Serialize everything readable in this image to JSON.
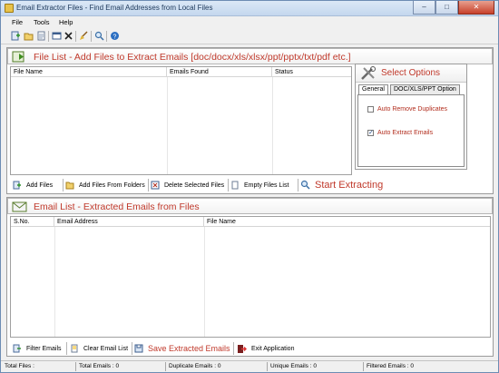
{
  "window": {
    "title": "Email Extractor Files -  Find Email Addresses from Local Files",
    "buttons": [
      "–",
      "□",
      "✕"
    ]
  },
  "menu": [
    "File",
    "Tools",
    "Help"
  ],
  "file_list": {
    "header": "File List - Add Files to Extract Emails [doc/docx/xls/xlsx/ppt/pptx/txt/pdf etc.]",
    "columns": [
      "File Name",
      "Emails Found",
      "Status"
    ]
  },
  "options": {
    "title": "Select Options",
    "tabs": [
      "General",
      "DOC/XLS/PPT Option"
    ],
    "checkboxes": [
      {
        "label": "Auto Remove Duplicates",
        "checked": false
      },
      {
        "label": "Auto Extract Emails",
        "checked": true
      }
    ]
  },
  "file_actions": {
    "add_files": "Add Files",
    "add_folders": "Add Files From Folders",
    "delete_selected": "Delete Selected Files",
    "empty_list": "Empty Files List",
    "start": "Start Extracting"
  },
  "email_list": {
    "header": "Email List - Extracted Emails from Files",
    "columns": [
      "S.No.",
      "Email Address",
      "File Name"
    ]
  },
  "email_actions": {
    "filter": "Filter Emails",
    "clear": "Clear Email List",
    "save": "Save Extracted Emails",
    "exit": "Exit Application"
  },
  "status": {
    "total_files": "Total Files :",
    "total_emails": "Total Emails :  0",
    "duplicate_emails": "Duplicate Emails :  0",
    "unique_emails": "Unique Emails :  0",
    "filtered_emails": "Filtered Emails :  0"
  },
  "colors": {
    "accent_red": "#c0392b",
    "title_blue": "#1e395b"
  }
}
